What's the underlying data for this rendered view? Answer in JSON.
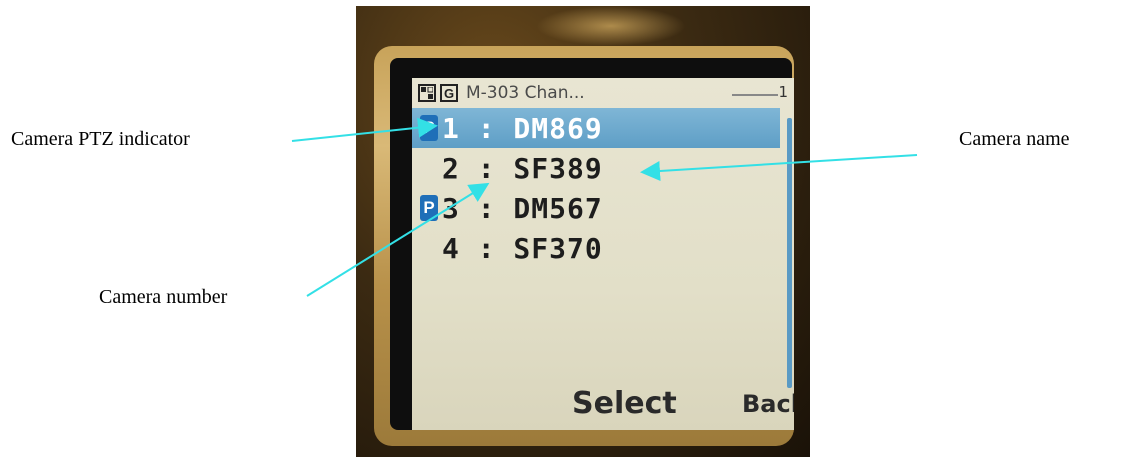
{
  "annotations": {
    "ptz_label": "Camera PTZ indicator",
    "name_label": "Camera name",
    "number_label": "Camera number"
  },
  "phone": {
    "status_bar": {
      "icon1": "network-icon",
      "icon2_label": "G",
      "title": "M-303 Chan...",
      "count": "1"
    },
    "cameras": [
      {
        "number": "1",
        "name": "DM869",
        "ptz": true,
        "selected": true,
        "text": "1 : DM869"
      },
      {
        "number": "2",
        "name": "SF389",
        "ptz": false,
        "selected": false,
        "text": "2 : SF389"
      },
      {
        "number": "3",
        "name": "DM567",
        "ptz": true,
        "selected": false,
        "text": "3 : DM567"
      },
      {
        "number": "4",
        "name": "SF370",
        "ptz": false,
        "selected": false,
        "text": "4 : SF370"
      }
    ],
    "ptz_badge": "P",
    "softkeys": {
      "select": "Select",
      "back": "Back"
    }
  },
  "colors": {
    "arrow": "#33e0e6",
    "highlight": "#6aaad0",
    "ptz_badge": "#1f6fb8"
  }
}
